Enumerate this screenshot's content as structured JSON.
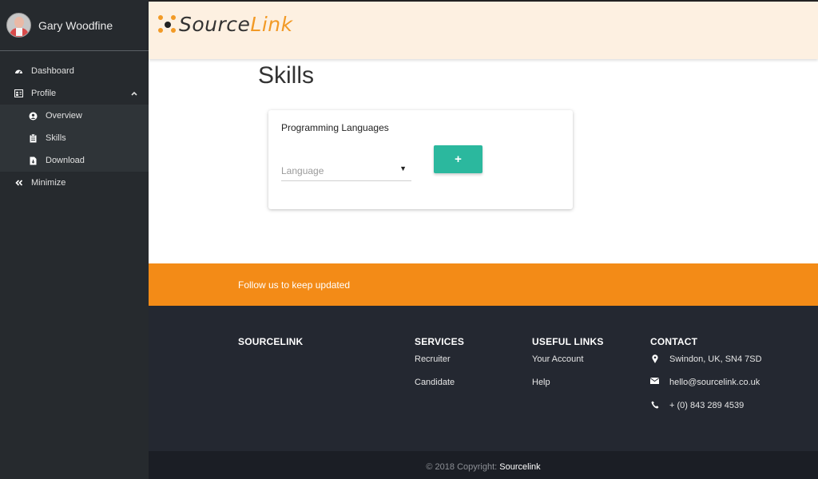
{
  "sidebar": {
    "user_name": "Gary Woodfine",
    "items": [
      {
        "label": "Dashboard",
        "icon": "dashboard-icon"
      },
      {
        "label": "Profile",
        "icon": "profile-card-icon",
        "expanded": true
      },
      {
        "label": "Overview",
        "icon": "user-circle-icon"
      },
      {
        "label": "Skills",
        "icon": "clipboard-icon"
      },
      {
        "label": "Download",
        "icon": "file-download-icon"
      },
      {
        "label": "Minimize",
        "icon": "double-chevron-left-icon"
      }
    ]
  },
  "header": {
    "logo_part1": "Source",
    "logo_part2": "Link",
    "accent_color": "#f29a26"
  },
  "main": {
    "title": "Skills",
    "card": {
      "title": "Programming Languages",
      "select_placeholder": "Language",
      "add_label": "+"
    }
  },
  "follow": {
    "text": "Follow us to keep updated",
    "color": "#f38b17"
  },
  "footer": {
    "brand_heading": "SOURCELINK",
    "services": {
      "heading": "SERVICES",
      "links": [
        "Recruiter",
        "Candidate"
      ]
    },
    "useful": {
      "heading": "USEFUL LINKS",
      "links": [
        "Your Account",
        "Help"
      ]
    },
    "contact": {
      "heading": "CONTACT",
      "address": "Swindon, UK, SN4 7SD",
      "email": "hello@sourcelink.co.uk",
      "phone": "+ (0) 843 289 4539"
    },
    "copyright_prefix": "© 2018 Copyright:",
    "copyright_brand": "Sourcelink"
  }
}
